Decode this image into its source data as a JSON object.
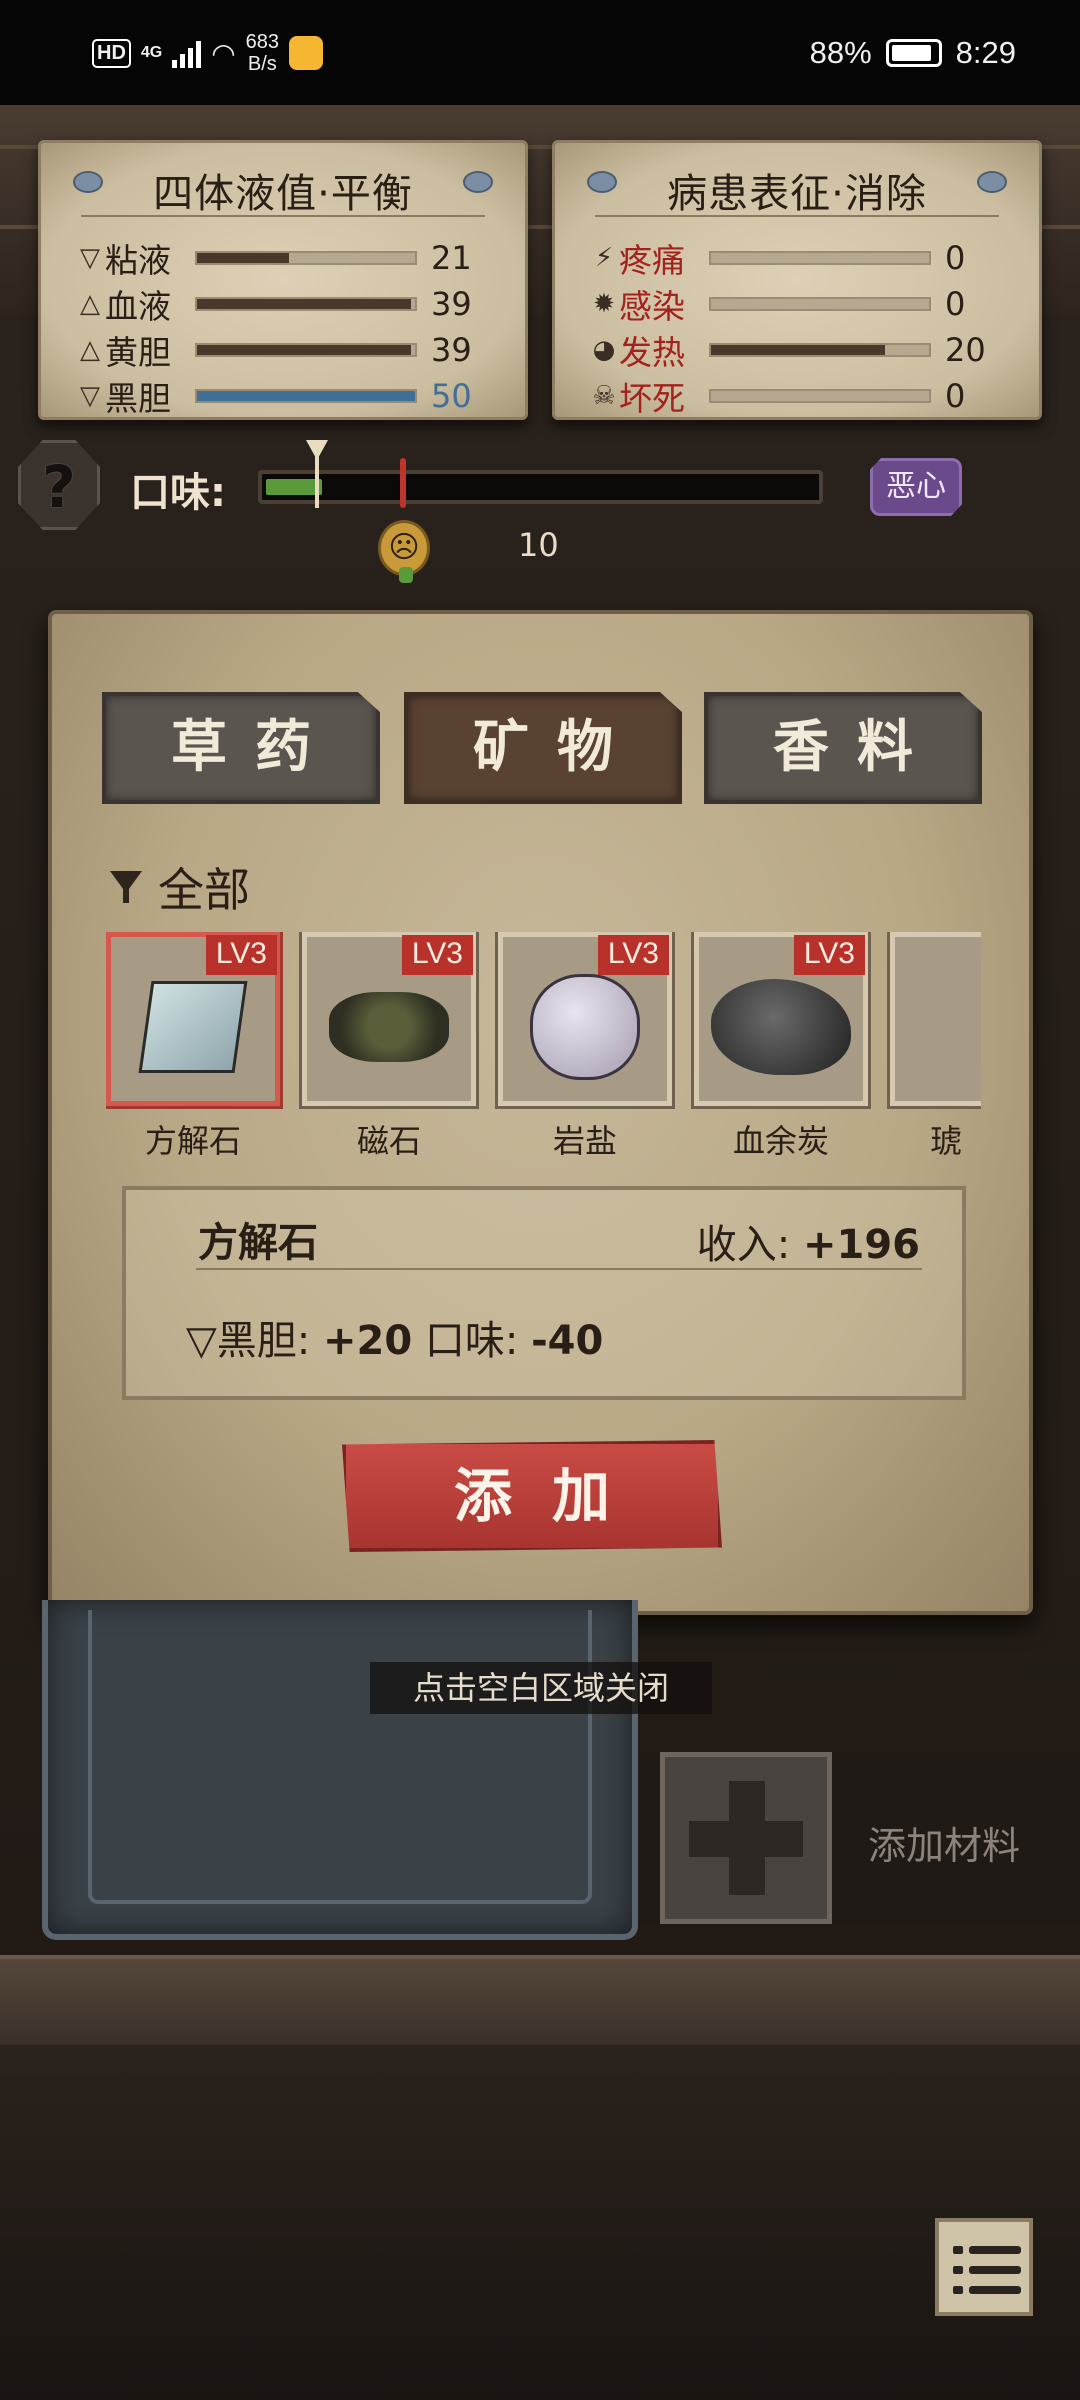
{
  "status_bar": {
    "hd": "HD",
    "network": "4G",
    "speed": "683",
    "speed_unit": "B/s",
    "battery": "88%",
    "time": "8:29"
  },
  "humors": {
    "title": "四体液值·平衡",
    "rows": [
      {
        "label": "粘液",
        "value": "21",
        "level": 0.42,
        "icon": "phlegm-triangle-icon"
      },
      {
        "label": "血液",
        "value": "39",
        "level": 0.98,
        "icon": "blood-triangle-icon"
      },
      {
        "label": "黄胆",
        "value": "39",
        "level": 0.98,
        "icon": "yellow-bile-triangle-icon"
      },
      {
        "label": "黑胆",
        "value": "50",
        "level": 1.0,
        "icon": "black-bile-triangle-icon"
      }
    ]
  },
  "symptoms": {
    "title": "病患表征·消除",
    "rows": [
      {
        "label": "疼痛",
        "value": "0",
        "level": 0,
        "icon": "pain-icon"
      },
      {
        "label": "感染",
        "value": "0",
        "level": 0,
        "icon": "infection-icon"
      },
      {
        "label": "发热",
        "value": "20",
        "level": 0.8,
        "icon": "fever-icon"
      },
      {
        "label": "坏死",
        "value": "0",
        "level": 0,
        "icon": "necrosis-skull-icon"
      }
    ]
  },
  "taste": {
    "label": "口味:",
    "value": "10",
    "state": "恶心",
    "fill": 0.1
  },
  "tabs": [
    {
      "label": "草药",
      "active": false
    },
    {
      "label": "矿物",
      "active": true
    },
    {
      "label": "香料",
      "active": false
    }
  ],
  "filter": {
    "label": "全部"
  },
  "items": [
    {
      "name": "方解石",
      "level": "LV3",
      "art": "calcite",
      "selected": true
    },
    {
      "name": "磁石",
      "level": "LV3",
      "art": "magnet",
      "selected": false
    },
    {
      "name": "岩盐",
      "level": "LV3",
      "art": "salt",
      "selected": false
    },
    {
      "name": "血余炭",
      "level": "LV3",
      "art": "coal",
      "selected": false
    },
    {
      "name": "琥",
      "level": "",
      "art": "amber",
      "selected": false
    }
  ],
  "detail": {
    "name": "方解石",
    "income_label": "收入:",
    "income_value": "+196",
    "effect1_label": "黑胆:",
    "effect1_value": "+20",
    "effect2_label": "口味:",
    "effect2_value": "-40"
  },
  "add_button": "添加",
  "close_hint": "点击空白区域关闭",
  "add_material": "添加材料",
  "colors": {
    "accent_red": "#b8322b",
    "black_bile_blue": "#3f6f96",
    "taste_green": "#5a9a3a",
    "nausea_purple": "#6a4a8a"
  }
}
